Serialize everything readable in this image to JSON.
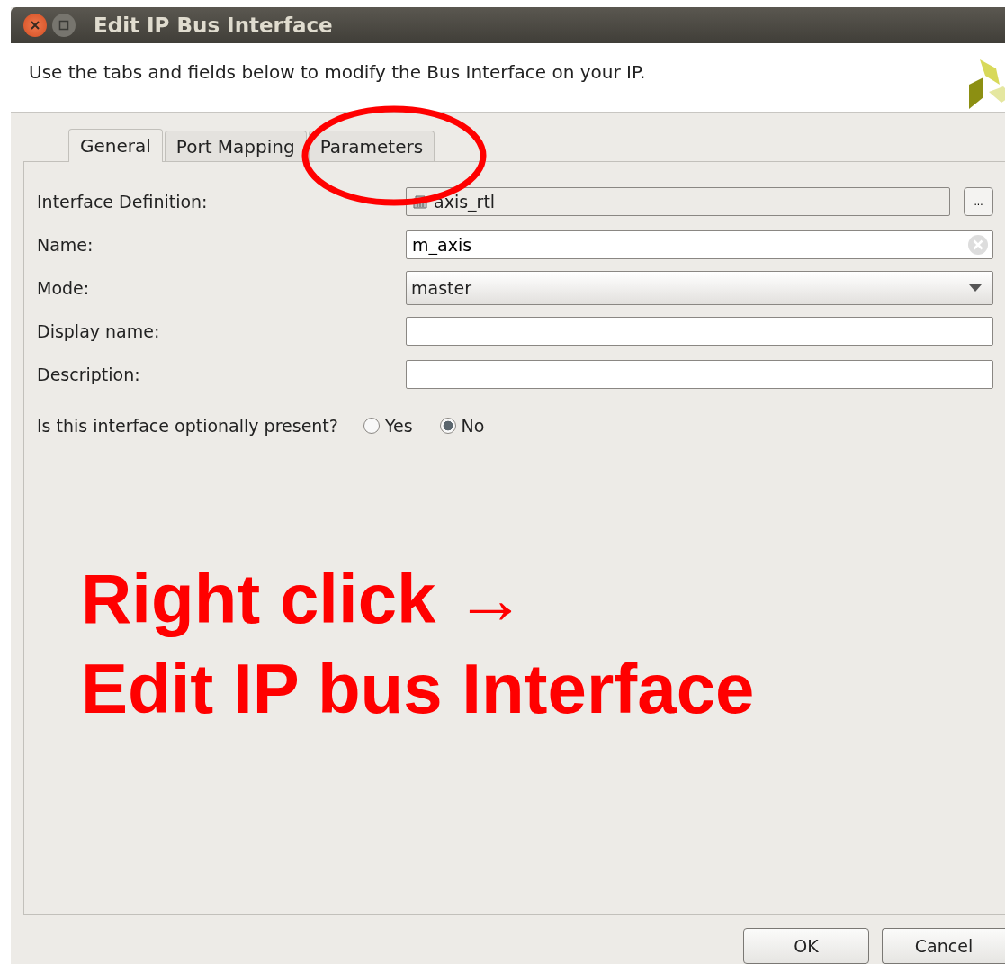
{
  "window": {
    "title": "Edit IP Bus Interface"
  },
  "header": {
    "description": "Use the tabs and fields below to modify the Bus Interface on your IP."
  },
  "tabs": [
    {
      "label": "General",
      "selected": true
    },
    {
      "label": "Port Mapping",
      "selected": false
    },
    {
      "label": "Parameters",
      "selected": false
    }
  ],
  "fields": [
    {
      "kind": "readonly",
      "label": "Interface Definition:",
      "value": "axis_rtl",
      "browse": "..."
    },
    {
      "kind": "text",
      "label": "Name:",
      "value": "m_axis",
      "clearable": true
    },
    {
      "kind": "dropdown",
      "label": "Mode:",
      "value": "master"
    },
    {
      "kind": "text",
      "label": "Display name:"
    },
    {
      "kind": "text",
      "label": "Description:"
    }
  ],
  "optional_present": {
    "label": "Is this interface optionally present?",
    "options": [
      {
        "label": "Yes",
        "selected": false
      },
      {
        "label": "No",
        "selected": true
      }
    ]
  },
  "buttons": [
    "OK",
    "Cancel"
  ],
  "annotation": {
    "lines": [
      "Right click →",
      "Edit IP bus Interface"
    ]
  }
}
